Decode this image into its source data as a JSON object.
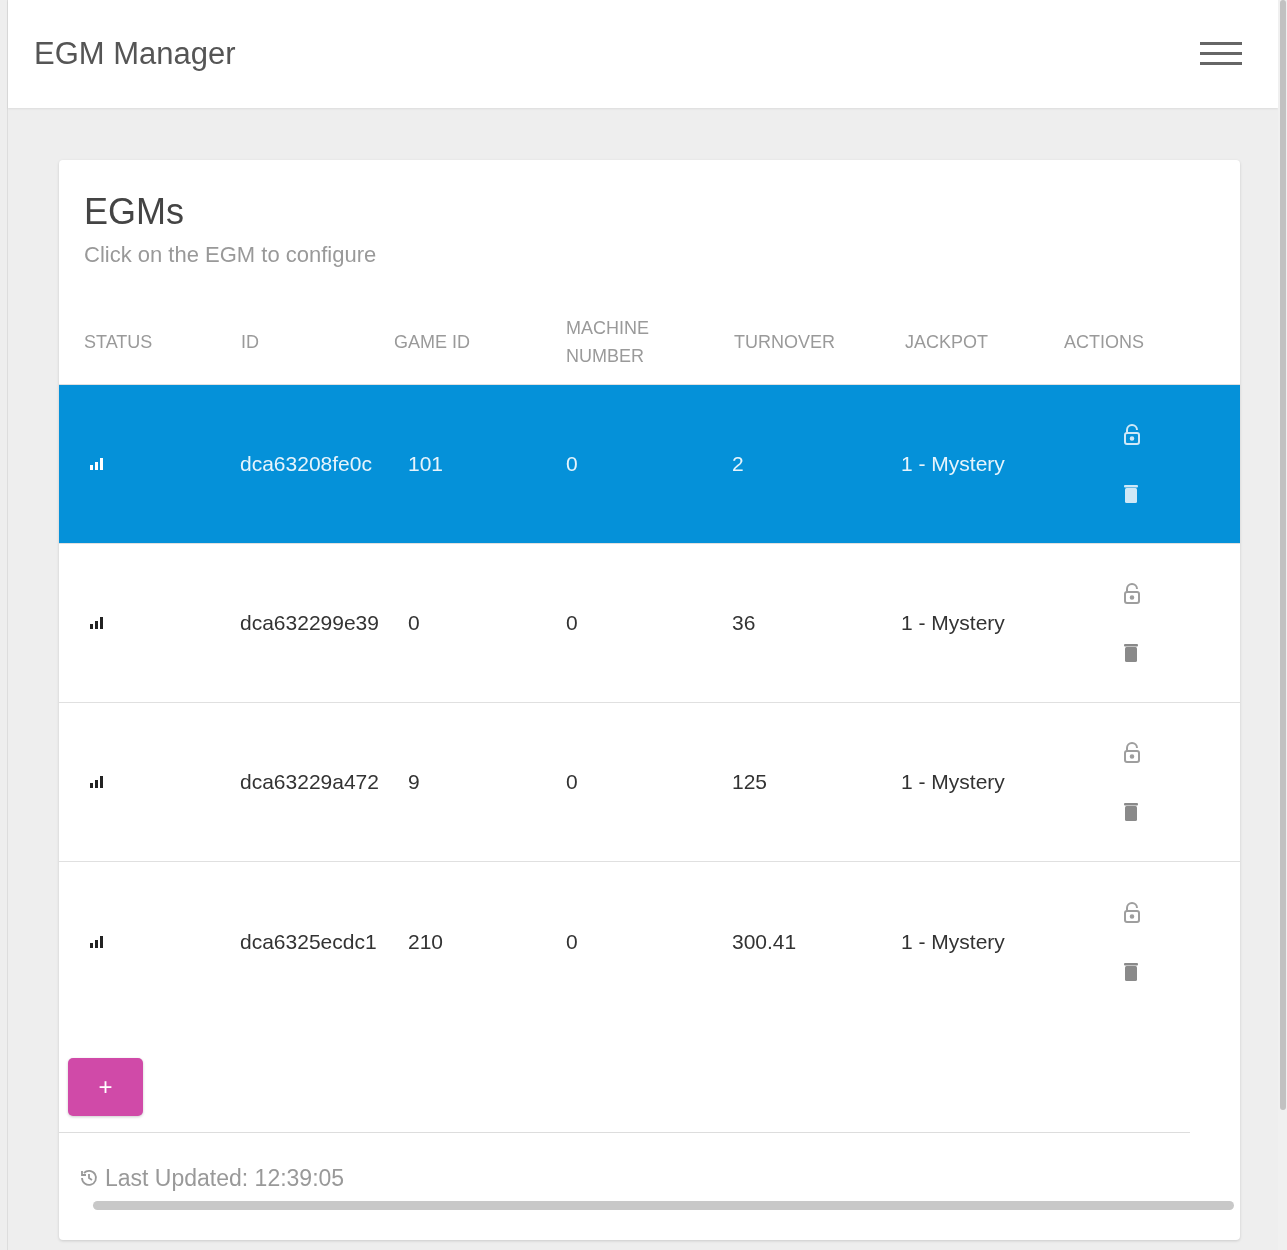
{
  "app_bar": {
    "title": "EGM Manager"
  },
  "card": {
    "title": "EGMs",
    "subtitle": "Click on the EGM to configure"
  },
  "table": {
    "columns": [
      "STATUS",
      "ID",
      "GAME ID",
      "MACHINE NUMBER",
      "TURNOVER",
      "JACKPOT",
      "ACTIONS"
    ],
    "rows": [
      {
        "selected": true,
        "id": "dca63208fe0c",
        "game_id": "101",
        "machine_number": "0",
        "turnover": "2",
        "jackpot": "1 - Mystery"
      },
      {
        "selected": false,
        "id": "dca632299e39",
        "game_id": "0",
        "machine_number": "0",
        "turnover": "36",
        "jackpot": "1 - Mystery"
      },
      {
        "selected": false,
        "id": "dca63229a472",
        "game_id": "9",
        "machine_number": "0",
        "turnover": "125",
        "jackpot": "1 - Mystery"
      },
      {
        "selected": false,
        "id": "dca6325ecdc1",
        "game_id": "210",
        "machine_number": "0",
        "turnover": "300.41",
        "jackpot": "1 - Mystery"
      }
    ]
  },
  "add_button": {
    "label": "+"
  },
  "footer": {
    "last_updated": "Last Updated: 12:39:05"
  }
}
